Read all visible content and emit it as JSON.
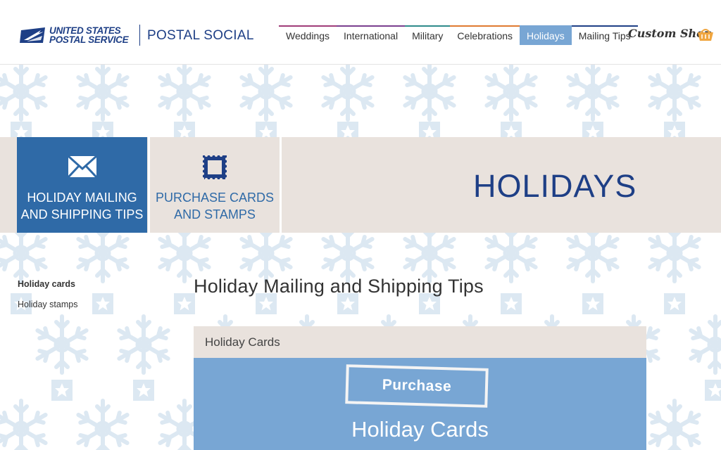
{
  "header": {
    "logo_line1": "UNITED STATES",
    "logo_line2": "POSTAL SERVICE",
    "brand": "POSTAL SOCIAL",
    "custom_shop": "Custom Shop"
  },
  "nav": {
    "items": [
      {
        "label": "Weddings",
        "accent": "#a03c78",
        "active": false
      },
      {
        "label": "International",
        "accent": "#7a3f8e",
        "active": false
      },
      {
        "label": "Military",
        "accent": "#2e8b8a",
        "active": false
      },
      {
        "label": "Celebrations",
        "accent": "#e07a30",
        "active": false
      },
      {
        "label": "Holidays",
        "accent": "#78a6d4",
        "active": true
      },
      {
        "label": "Mailing Tips",
        "accent": "#1e3f86",
        "active": false
      }
    ]
  },
  "banner": {
    "tile1_line1": "HOLIDAY MAILING",
    "tile1_line2": "AND SHIPPING TIPS",
    "tile2_line1": "PURCHASE CARDS",
    "tile2_line2": "AND STAMPS",
    "title": "HOLIDAYS"
  },
  "sidebar": {
    "items": [
      {
        "label": "Holiday cards",
        "active": true
      },
      {
        "label": "Holiday stamps",
        "active": false
      }
    ]
  },
  "main": {
    "section_title": "Holiday Mailing and Shipping Tips",
    "card": {
      "header": "Holiday Cards",
      "stamp_text": "Purchase",
      "title": "Holiday Cards"
    }
  },
  "colors": {
    "brand_blue": "#1e3f86",
    "tile_blue": "#2f6aa7",
    "light_blue": "#78a6d4",
    "beige": "#e9e2dd",
    "pattern": "#dde9f3"
  },
  "icons": [
    "envelope-icon",
    "stamp-icon",
    "basket-icon",
    "eagle-logo",
    "snowflake-pattern",
    "star-pattern"
  ]
}
